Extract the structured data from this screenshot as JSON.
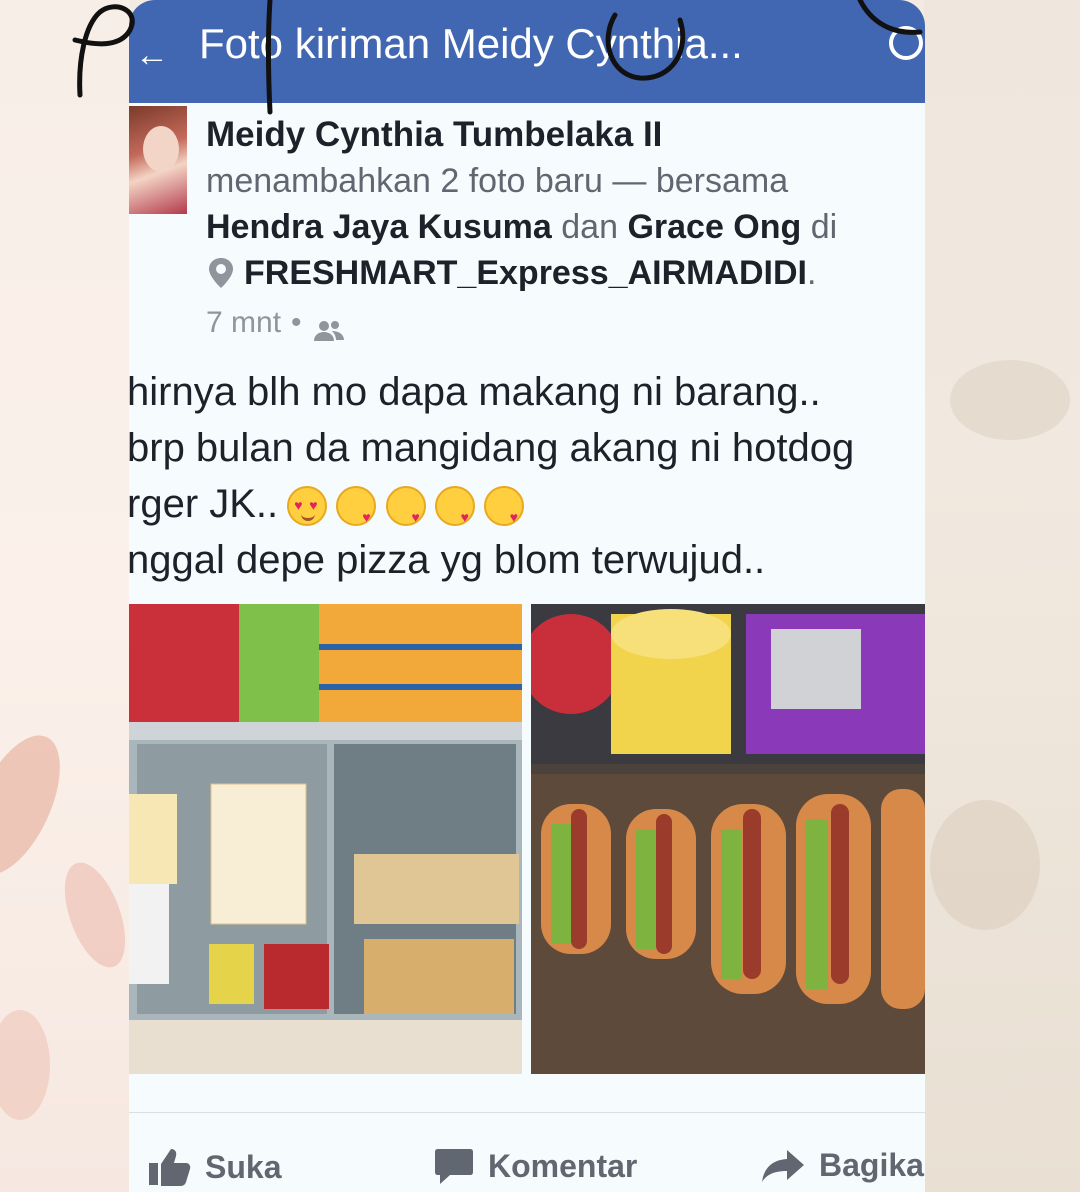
{
  "header": {
    "title": "Foto kiriman Meidy Cynthia...",
    "back_icon": "←"
  },
  "post": {
    "author": "Meidy Cynthia Tumbelaka II",
    "action_text": "menambahkan 2 foto baru — bersama",
    "tagged_1": "Hendra Jaya Kusuma",
    "and_word": "dan",
    "tagged_2": "Grace Ong",
    "at_word": "di",
    "location": "FRESHMART_Express_AIRMADIDI",
    "location_suffix": ".",
    "time": "7 mnt",
    "separator": "•",
    "caption_lines": [
      "hirnya blh mo dapa makang ni barang..",
      " brp bulan da mangidang akang ni hotdog",
      "rger JK..",
      "nggal depe pizza yg blom terwujud.."
    ]
  },
  "actions": {
    "like": "Suka",
    "comment": "Komentar",
    "share": "Bagika"
  },
  "colors": {
    "header_bg": "#4267b2",
    "text_primary": "#1d2129",
    "text_secondary": "#616770"
  },
  "icons": [
    "back-arrow-icon",
    "search-icon",
    "location-pin-icon",
    "friends-icon",
    "thumbs-up-icon",
    "comment-icon",
    "share-icon"
  ]
}
